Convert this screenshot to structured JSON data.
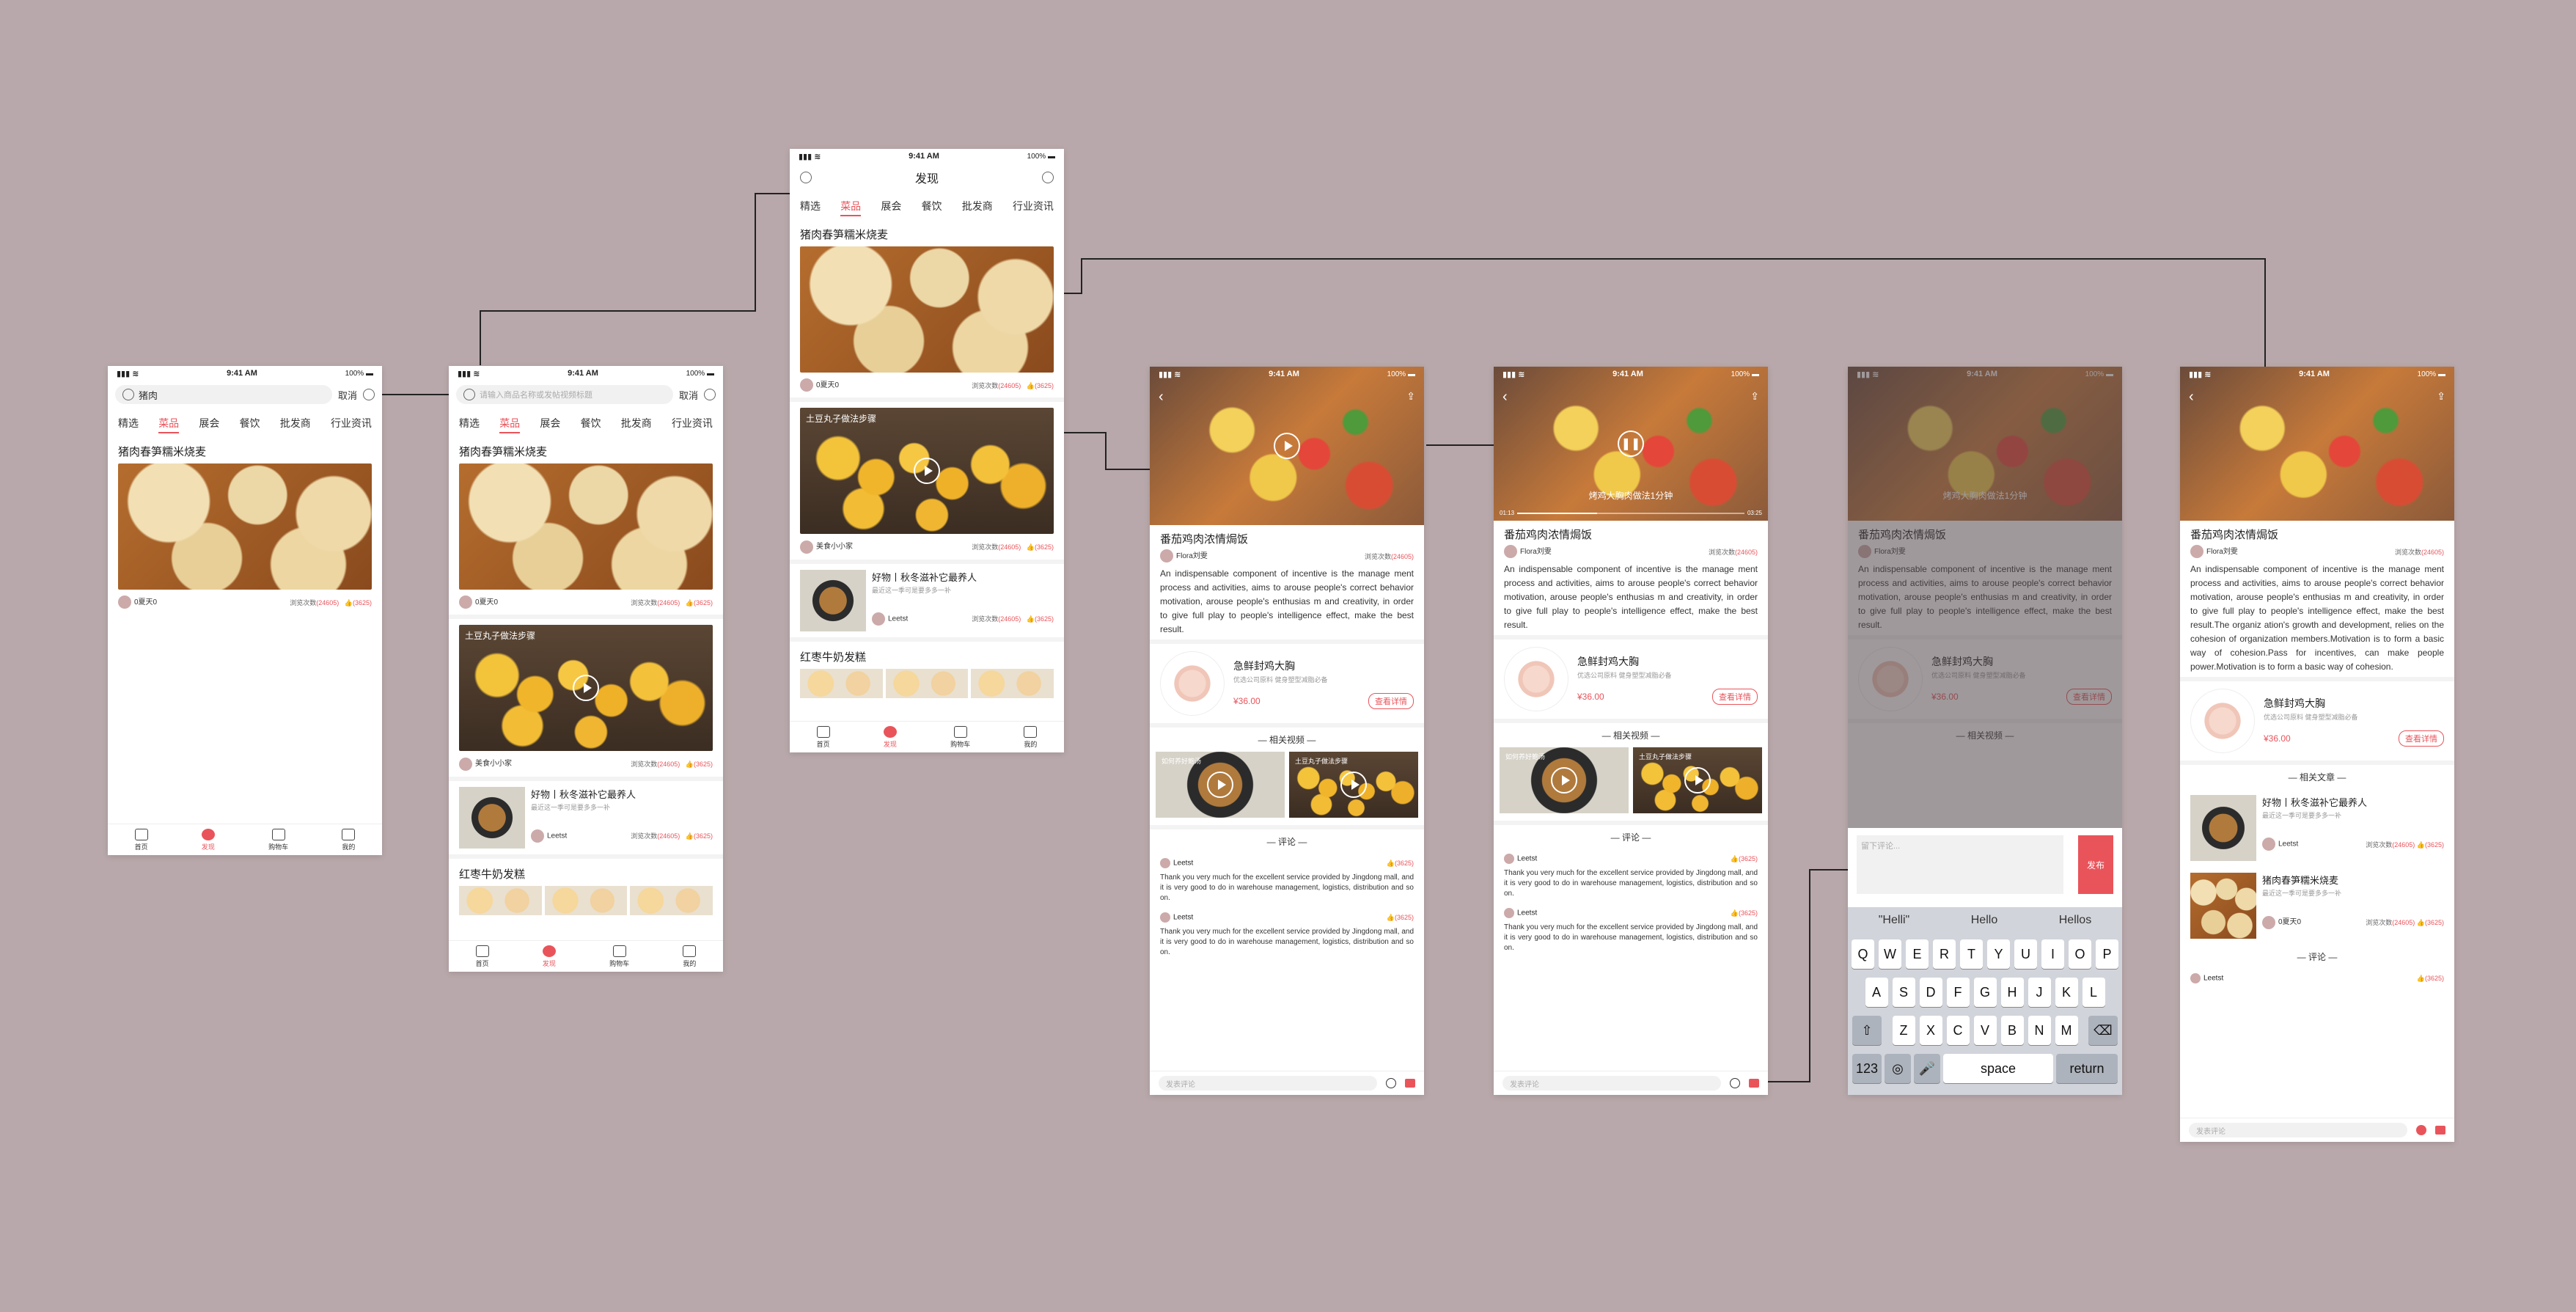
{
  "status": {
    "time": "9:41 AM",
    "battery": "100%"
  },
  "tabs": [
    "精选",
    "菜品",
    "展会",
    "餐饮",
    "批发商",
    "行业资讯"
  ],
  "screen1": {
    "query": "猪肉",
    "cancel": "取消"
  },
  "screen2": {
    "placeholder": "请输入商品名称或发帖视频标题",
    "cancel": "取消"
  },
  "screen3": {
    "header_title": "发现"
  },
  "feed": {
    "item1_title": "猪肉春笋糯米烧麦",
    "item1_author": "0夏天0",
    "views_label": "浏览次数",
    "views_count": "(24605)",
    "likes": "(3625)",
    "video_title": "土豆丸子做法步骤",
    "video_author": "美食小小家",
    "article_title": "好物丨秋冬滋补它最养人",
    "article_sub": "最近这一季可是要多多一补",
    "article_author": "Leetst",
    "next_title": "红枣牛奶发糕"
  },
  "tabbar": [
    "首页",
    "发现",
    "购物车",
    "我的"
  ],
  "detail": {
    "title": "番茄鸡肉浓情焗饭",
    "author": "Flora刘雯",
    "views": "浏览次数",
    "views_count": "(24605)",
    "desc": "An indispensable component of incentive is the manage ment process and activities, aims to arouse people's correct behavior motivation, arouse people's enthusias m and creativity, in order to give full play to people's intelligence effect, make the best result.",
    "desc_long": "An indispensable component of incentive is the manage ment process and activities, aims to arouse people's correct behavior motivation, arouse people's enthusias m and creativity, in order to give full play to people's intelligence effect, make the best result.The organiz ation's growth and development, relies on the cohesion of organization members.Motivation is to form a basic way of cohesion.Pass for incentives, can make people power.Motivation is to form a basic way of cohesion.",
    "product_name": "急鲜封鸡大胸",
    "product_sub": "优选公司原料 健身塑型减脂必备",
    "price": "¥36.00",
    "view_detail": "查看详情",
    "related_videos": "— 相关视频 —",
    "related_articles": "— 相关文章 —",
    "video1": "如何养好鲍汤",
    "video2": "土豆丸子做法步骤",
    "comments": "— 评论 —",
    "commenter": "Leetst",
    "comment_likes": "(3625)",
    "comment_text": "Thank you very much for the excellent service provided by Jingdong mall, and it is very good to do in warehouse management, logistics, distribution and so on.",
    "comment_input": "发表评论",
    "playing_text": "烤鸡大胸肉做法1分钟",
    "time_start": "01:13",
    "time_end": "03:25",
    "rel_article1": "好物丨秋冬滋补它最养人",
    "rel_article1_sub": "最近这一季可是要多多一补",
    "rel_article2": "猪肉春笋糯米烧麦",
    "rel_article2_sub": "最近这一季可是要多多一补"
  },
  "keyboard": {
    "input_placeholder": "留下评论...",
    "send": "发布",
    "suggestions": [
      "\"Helli\"",
      "Hello",
      "Hellos"
    ],
    "row1": [
      "Q",
      "W",
      "E",
      "R",
      "T",
      "Y",
      "U",
      "I",
      "O",
      "P"
    ],
    "row2": [
      "A",
      "S",
      "D",
      "F",
      "G",
      "H",
      "J",
      "K",
      "L"
    ],
    "row3": [
      "Z",
      "X",
      "C",
      "V",
      "B",
      "N",
      "M"
    ],
    "num": "123",
    "space": "space",
    "return": "return"
  },
  "colors": {
    "background": "#b8a8ab",
    "accent": "#e9545b"
  }
}
